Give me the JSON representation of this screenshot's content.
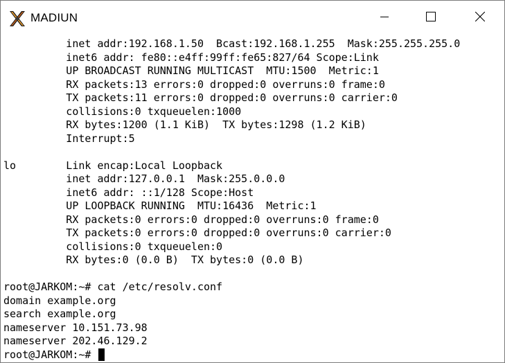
{
  "window": {
    "title": "MADIUN",
    "app_icon": "x-logo-icon",
    "controls": {
      "minimize": "minimize-icon",
      "maximize": "maximize-icon",
      "close": "close-icon"
    }
  },
  "terminal": {
    "lines": [
      "          inet addr:192.168.1.50  Bcast:192.168.1.255  Mask:255.255.255.0",
      "          inet6 addr: fe80::e4ff:99ff:fe65:827/64 Scope:Link",
      "          UP BROADCAST RUNNING MULTICAST  MTU:1500  Metric:1",
      "          RX packets:13 errors:0 dropped:0 overruns:0 frame:0",
      "          TX packets:11 errors:0 dropped:0 overruns:0 carrier:0",
      "          collisions:0 txqueuelen:1000",
      "          RX bytes:1200 (1.1 KiB)  TX bytes:1298 (1.2 KiB)",
      "          Interrupt:5",
      "",
      "lo        Link encap:Local Loopback",
      "          inet addr:127.0.0.1  Mask:255.0.0.0",
      "          inet6 addr: ::1/128 Scope:Host",
      "          UP LOOPBACK RUNNING  MTU:16436  Metric:1",
      "          RX packets:0 errors:0 dropped:0 overruns:0 frame:0",
      "          TX packets:0 errors:0 dropped:0 overruns:0 carrier:0",
      "          collisions:0 txqueuelen:0",
      "          RX bytes:0 (0.0 B)  TX bytes:0 (0.0 B)",
      "",
      "root@JARKOM:~# cat /etc/resolv.conf",
      "domain example.org",
      "search example.org",
      "nameserver 10.151.73.98",
      "nameserver 202.46.129.2",
      "root@JARKOM:~# "
    ]
  }
}
